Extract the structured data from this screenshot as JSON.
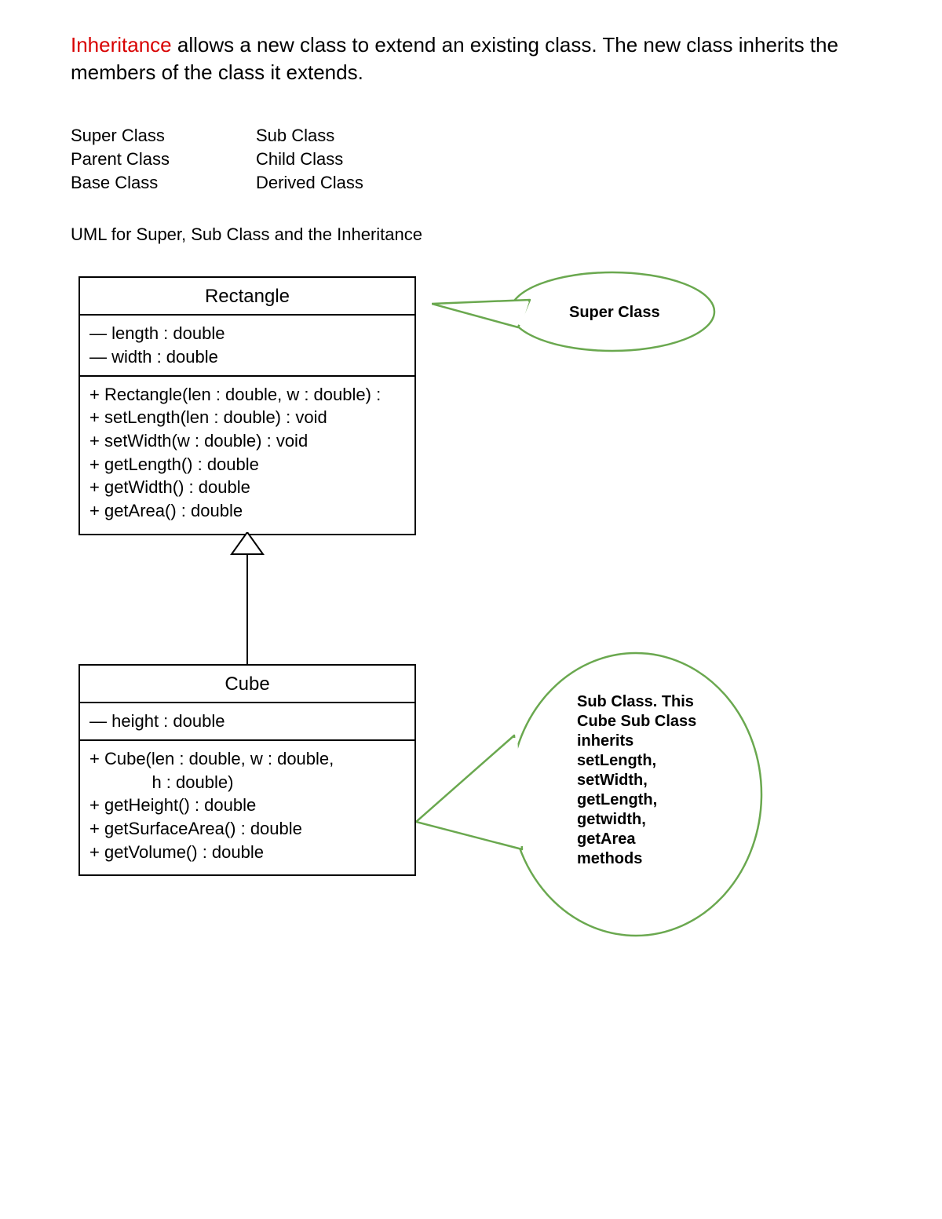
{
  "intro": {
    "keyword": "Inheritance",
    "rest": " allows a new class to extend an existing class. The new class inherits the members of the class it extends."
  },
  "terms": {
    "left": [
      "Super Class",
      "Parent Class",
      "Base Class"
    ],
    "right": [
      "Sub Class",
      "Child Class",
      "Derived Class"
    ]
  },
  "caption": "UML for Super, Sub Class and the Inheritance",
  "uml": {
    "rectangle": {
      "name": "Rectangle",
      "attrs": [
        "— length : double",
        "— width : double"
      ],
      "methods": [
        "+ Rectangle(len : double, w : double) :",
        "+ setLength(len : double) : void",
        "+ setWidth(w : double) : void",
        "+ getLength() : double",
        "+ getWidth() : double",
        "+ getArea() : double"
      ]
    },
    "cube": {
      "name": "Cube",
      "attrs": [
        "— height : double"
      ],
      "methods": [
        "+ Cube(len : double, w : double,",
        "             h : double)",
        "+ getHeight() : double",
        "+ getSurfaceArea() : double",
        "+ getVolume() : double"
      ]
    }
  },
  "callouts": {
    "super": "Super Class",
    "sub_lines": [
      "Sub Class. This",
      "Cube Sub Class",
      "inherits",
      "setLength,",
      "setWidth,",
      "getLength,",
      "getwidth,",
      "getArea",
      "methods"
    ]
  },
  "colors": {
    "keyword": "#d80000",
    "callout_border": "#6aa84f"
  }
}
